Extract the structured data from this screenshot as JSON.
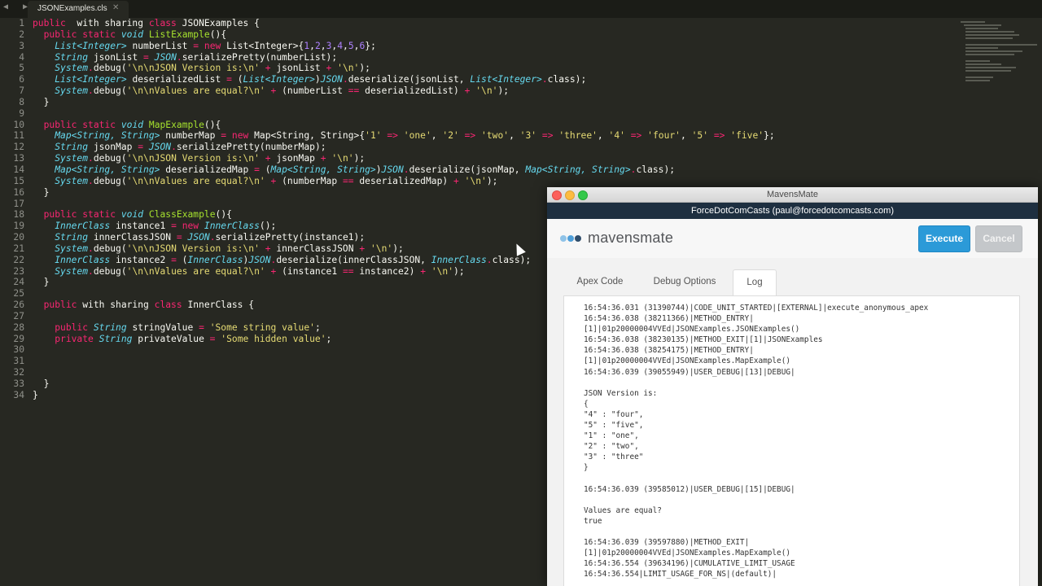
{
  "editor": {
    "tab_arrows": "◀ ▶",
    "tab_label": "JSONExamples.cls",
    "tab_close": "✕",
    "line_numbers": [
      "1",
      "2",
      "3",
      "4",
      "5",
      "6",
      "7",
      "8",
      "9",
      "10",
      "11",
      "12",
      "13",
      "14",
      "15",
      "16",
      "17",
      "18",
      "19",
      "20",
      "21",
      "22",
      "23",
      "24",
      "25",
      "26",
      "27",
      "28",
      "29",
      "30",
      "31",
      "32",
      "33",
      "34"
    ],
    "lines": [
      [
        [
          "k",
          "public"
        ],
        [
          "",
          "  with sharing "
        ],
        [
          "k",
          "class"
        ],
        [
          "",
          " JSONExamples {"
        ]
      ],
      [
        [
          "",
          "  "
        ],
        [
          "k",
          "public"
        ],
        [
          "",
          " "
        ],
        [
          "k",
          "static"
        ],
        [
          "",
          " "
        ],
        [
          "t",
          "void"
        ],
        [
          "",
          " "
        ],
        [
          "f",
          "ListExample"
        ],
        [
          "",
          "(){"
        ]
      ],
      [
        [
          "",
          "    "
        ],
        [
          "t",
          "List<Integer>"
        ],
        [
          "",
          " numberList "
        ],
        [
          "p",
          "="
        ],
        [
          "",
          " "
        ],
        [
          "k",
          "new"
        ],
        [
          "",
          " List<Integer>{"
        ],
        [
          "n",
          "1"
        ],
        [
          "",
          ","
        ],
        [
          "n",
          "2"
        ],
        [
          "",
          ","
        ],
        [
          "n",
          "3"
        ],
        [
          "",
          ","
        ],
        [
          "n",
          "4"
        ],
        [
          "",
          ","
        ],
        [
          "n",
          "5"
        ],
        [
          "",
          ","
        ],
        [
          "n",
          "6"
        ],
        [
          "",
          "};"
        ]
      ],
      [
        [
          "",
          "    "
        ],
        [
          "t",
          "String"
        ],
        [
          "",
          " jsonList "
        ],
        [
          "p",
          "="
        ],
        [
          "",
          " "
        ],
        [
          "t",
          "JSON"
        ],
        [
          "p",
          "."
        ],
        [
          "",
          "serializePretty(numberList);"
        ]
      ],
      [
        [
          "",
          "    "
        ],
        [
          "t",
          "System"
        ],
        [
          "p",
          "."
        ],
        [
          "",
          "debug("
        ],
        [
          "s",
          "'\\n\\nJSON Version is:\\n'"
        ],
        [
          "",
          " "
        ],
        [
          "p",
          "+"
        ],
        [
          "",
          " jsonList "
        ],
        [
          "p",
          "+"
        ],
        [
          "",
          " "
        ],
        [
          "s",
          "'\\n'"
        ],
        [
          "",
          ");"
        ]
      ],
      [
        [
          "",
          "    "
        ],
        [
          "t",
          "List<Integer>"
        ],
        [
          "",
          " deserializedList "
        ],
        [
          "p",
          "="
        ],
        [
          "",
          " ("
        ],
        [
          "t",
          "List<Integer>"
        ],
        [
          "",
          ")"
        ],
        [
          "t",
          "JSON"
        ],
        [
          "p",
          "."
        ],
        [
          "",
          "deserialize(jsonList, "
        ],
        [
          "t",
          "List<Integer>"
        ],
        [
          "p",
          "."
        ],
        [
          "",
          "class);"
        ]
      ],
      [
        [
          "",
          "    "
        ],
        [
          "t",
          "System"
        ],
        [
          "p",
          "."
        ],
        [
          "",
          "debug("
        ],
        [
          "s",
          "'\\n\\nValues are equal?\\n'"
        ],
        [
          "",
          " "
        ],
        [
          "p",
          "+"
        ],
        [
          "",
          " (numberList "
        ],
        [
          "p",
          "=="
        ],
        [
          "",
          " deserializedList) "
        ],
        [
          "p",
          "+"
        ],
        [
          "",
          " "
        ],
        [
          "s",
          "'\\n'"
        ],
        [
          "",
          ");"
        ]
      ],
      [
        [
          "",
          "  }"
        ]
      ],
      [
        [
          "",
          ""
        ]
      ],
      [
        [
          "",
          "  "
        ],
        [
          "k",
          "public"
        ],
        [
          "",
          " "
        ],
        [
          "k",
          "static"
        ],
        [
          "",
          " "
        ],
        [
          "t",
          "void"
        ],
        [
          "",
          " "
        ],
        [
          "f",
          "MapExample"
        ],
        [
          "",
          "(){"
        ]
      ],
      [
        [
          "",
          "    "
        ],
        [
          "t",
          "Map<String, String>"
        ],
        [
          "",
          " numberMap "
        ],
        [
          "p",
          "="
        ],
        [
          "",
          " "
        ],
        [
          "k",
          "new"
        ],
        [
          "",
          " Map<String, String>{"
        ],
        [
          "s",
          "'1'"
        ],
        [
          "",
          " "
        ],
        [
          "p",
          "=>"
        ],
        [
          "",
          " "
        ],
        [
          "s",
          "'one'"
        ],
        [
          "",
          ", "
        ],
        [
          "s",
          "'2'"
        ],
        [
          "",
          " "
        ],
        [
          "p",
          "=>"
        ],
        [
          "",
          " "
        ],
        [
          "s",
          "'two'"
        ],
        [
          "",
          ", "
        ],
        [
          "s",
          "'3'"
        ],
        [
          "",
          " "
        ],
        [
          "p",
          "=>"
        ],
        [
          "",
          " "
        ],
        [
          "s",
          "'three'"
        ],
        [
          "",
          ", "
        ],
        [
          "s",
          "'4'"
        ],
        [
          "",
          " "
        ],
        [
          "p",
          "=>"
        ],
        [
          "",
          " "
        ],
        [
          "s",
          "'four'"
        ],
        [
          "",
          ", "
        ],
        [
          "s",
          "'5'"
        ],
        [
          "",
          " "
        ],
        [
          "p",
          "=>"
        ],
        [
          "",
          " "
        ],
        [
          "s",
          "'five'"
        ],
        [
          "",
          "};"
        ]
      ],
      [
        [
          "",
          "    "
        ],
        [
          "t",
          "String"
        ],
        [
          "",
          " jsonMap "
        ],
        [
          "p",
          "="
        ],
        [
          "",
          " "
        ],
        [
          "t",
          "JSON"
        ],
        [
          "p",
          "."
        ],
        [
          "",
          "serializePretty(numberMap);"
        ]
      ],
      [
        [
          "",
          "    "
        ],
        [
          "t",
          "System"
        ],
        [
          "p",
          "."
        ],
        [
          "",
          "debug("
        ],
        [
          "s",
          "'\\n\\nJSON Version is:\\n'"
        ],
        [
          "",
          " "
        ],
        [
          "p",
          "+"
        ],
        [
          "",
          " jsonMap "
        ],
        [
          "p",
          "+"
        ],
        [
          "",
          " "
        ],
        [
          "s",
          "'\\n'"
        ],
        [
          "",
          ");"
        ]
      ],
      [
        [
          "",
          "    "
        ],
        [
          "t",
          "Map<String, String>"
        ],
        [
          "",
          " deserializedMap "
        ],
        [
          "p",
          "="
        ],
        [
          "",
          " ("
        ],
        [
          "t",
          "Map<String, String>"
        ],
        [
          "",
          ")"
        ],
        [
          "t",
          "JSON"
        ],
        [
          "p",
          "."
        ],
        [
          "",
          "deserialize(jsonMap, "
        ],
        [
          "t",
          "Map<String, String>"
        ],
        [
          "p",
          "."
        ],
        [
          "",
          "class);"
        ]
      ],
      [
        [
          "",
          "    "
        ],
        [
          "t",
          "System"
        ],
        [
          "p",
          "."
        ],
        [
          "",
          "debug("
        ],
        [
          "s",
          "'\\n\\nValues are equal?\\n'"
        ],
        [
          "",
          " "
        ],
        [
          "p",
          "+"
        ],
        [
          "",
          " (numberMap "
        ],
        [
          "p",
          "=="
        ],
        [
          "",
          " deserializedMap) "
        ],
        [
          "p",
          "+"
        ],
        [
          "",
          " "
        ],
        [
          "s",
          "'\\n'"
        ],
        [
          "",
          ");"
        ]
      ],
      [
        [
          "",
          "  }"
        ]
      ],
      [
        [
          "",
          ""
        ]
      ],
      [
        [
          "",
          "  "
        ],
        [
          "k",
          "public"
        ],
        [
          "",
          " "
        ],
        [
          "k",
          "static"
        ],
        [
          "",
          " "
        ],
        [
          "t",
          "void"
        ],
        [
          "",
          " "
        ],
        [
          "f",
          "ClassExample"
        ],
        [
          "",
          "(){"
        ]
      ],
      [
        [
          "",
          "    "
        ],
        [
          "t",
          "InnerClass"
        ],
        [
          "",
          " instance1 "
        ],
        [
          "p",
          "="
        ],
        [
          "",
          " "
        ],
        [
          "k",
          "new"
        ],
        [
          "",
          " "
        ],
        [
          "t",
          "InnerClass"
        ],
        [
          "",
          "();"
        ]
      ],
      [
        [
          "",
          "    "
        ],
        [
          "t",
          "String"
        ],
        [
          "",
          " innerClassJSON "
        ],
        [
          "p",
          "="
        ],
        [
          "",
          " "
        ],
        [
          "t",
          "JSON"
        ],
        [
          "p",
          "."
        ],
        [
          "",
          "serializePretty(instance1);"
        ]
      ],
      [
        [
          "",
          "    "
        ],
        [
          "t",
          "System"
        ],
        [
          "p",
          "."
        ],
        [
          "",
          "debug("
        ],
        [
          "s",
          "'\\n\\nJSON Version is:\\n'"
        ],
        [
          "",
          " "
        ],
        [
          "p",
          "+"
        ],
        [
          "",
          " innerClassJSON "
        ],
        [
          "p",
          "+"
        ],
        [
          "",
          " "
        ],
        [
          "s",
          "'\\n'"
        ],
        [
          "",
          ");"
        ]
      ],
      [
        [
          "",
          "    "
        ],
        [
          "t",
          "InnerClass"
        ],
        [
          "",
          " instance2 "
        ],
        [
          "p",
          "="
        ],
        [
          "",
          " ("
        ],
        [
          "t",
          "InnerClass"
        ],
        [
          "",
          ")"
        ],
        [
          "t",
          "JSON"
        ],
        [
          "p",
          "."
        ],
        [
          "",
          "deserialize(innerClassJSON, "
        ],
        [
          "t",
          "InnerClass"
        ],
        [
          "p",
          "."
        ],
        [
          "",
          "class);"
        ]
      ],
      [
        [
          "",
          "    "
        ],
        [
          "t",
          "System"
        ],
        [
          "p",
          "."
        ],
        [
          "",
          "debug("
        ],
        [
          "s",
          "'\\n\\nValues are equal?\\n'"
        ],
        [
          "",
          " "
        ],
        [
          "p",
          "+"
        ],
        [
          "",
          " (instance1 "
        ],
        [
          "p",
          "=="
        ],
        [
          "",
          " instance2) "
        ],
        [
          "p",
          "+"
        ],
        [
          "",
          " "
        ],
        [
          "s",
          "'\\n'"
        ],
        [
          "",
          ");"
        ]
      ],
      [
        [
          "",
          "  }"
        ]
      ],
      [
        [
          "",
          ""
        ]
      ],
      [
        [
          "",
          "  "
        ],
        [
          "k",
          "public"
        ],
        [
          "",
          " with sharing "
        ],
        [
          "k",
          "class"
        ],
        [
          "",
          " InnerClass {"
        ]
      ],
      [
        [
          "",
          ""
        ]
      ],
      [
        [
          "",
          "    "
        ],
        [
          "k",
          "public"
        ],
        [
          "",
          " "
        ],
        [
          "t",
          "String"
        ],
        [
          "",
          " stringValue "
        ],
        [
          "p",
          "="
        ],
        [
          "",
          " "
        ],
        [
          "s",
          "'Some string value'"
        ],
        [
          "",
          ";"
        ]
      ],
      [
        [
          "",
          "    "
        ],
        [
          "k",
          "private"
        ],
        [
          "",
          " "
        ],
        [
          "t",
          "String"
        ],
        [
          "",
          " privateValue "
        ],
        [
          "p",
          "="
        ],
        [
          "",
          " "
        ],
        [
          "s",
          "'Some hidden value'"
        ],
        [
          "",
          ";"
        ]
      ],
      [
        [
          "",
          ""
        ]
      ],
      [
        [
          "",
          ""
        ]
      ],
      [
        [
          "",
          ""
        ]
      ],
      [
        [
          "",
          "  }"
        ]
      ],
      [
        [
          "",
          "}"
        ]
      ]
    ]
  },
  "mavensmate": {
    "window_title": "MavensMate",
    "org_label": "ForceDotComCasts (paul@forcedotcomcasts.com)",
    "logo_text": "mavensmate",
    "logo_dot_colors": [
      "#8fc3e8",
      "#4f9fd9",
      "#2f4d6b"
    ],
    "execute_label": "Execute",
    "cancel_label": "Cancel",
    "tabs": {
      "apex_code": "Apex Code",
      "debug_options": "Debug Options",
      "log": "Log"
    },
    "active_tab": "Log",
    "log_text": "16:54:36.031 (31390744)|CODE_UNIT_STARTED|[EXTERNAL]|execute_anonymous_apex\n16:54:36.038 (38211366)|METHOD_ENTRY|\n[1]|01p20000004VVEd|JSONExamples.JSONExamples()\n16:54:36.038 (38230135)|METHOD_EXIT|[1]|JSONExamples\n16:54:36.038 (38254175)|METHOD_ENTRY|\n[1]|01p20000004VVEd|JSONExamples.MapExample()\n16:54:36.039 (39055949)|USER_DEBUG|[13]|DEBUG|\n\nJSON Version is:\n{\n\"4\" : \"four\",\n\"5\" : \"five\",\n\"1\" : \"one\",\n\"2\" : \"two\",\n\"3\" : \"three\"\n}\n\n16:54:36.039 (39585012)|USER_DEBUG|[15]|DEBUG|\n\nValues are equal?\ntrue\n\n16:54:36.039 (39597880)|METHOD_EXIT|\n[1]|01p20000004VVEd|JSONExamples.MapExample()\n16:54:36.554 (39634196)|CUMULATIVE_LIMIT_USAGE\n16:54:36.554|LIMIT_USAGE_FOR_NS|(default)|"
  },
  "colors": {
    "editor_bg": "#272822",
    "keyword": "#f92672",
    "type": "#66d9ef",
    "function": "#a6e22e",
    "string": "#e6db74",
    "number": "#ae81ff",
    "execute_bg": "#2b9ad8",
    "org_bar_bg": "#1e2f40"
  }
}
